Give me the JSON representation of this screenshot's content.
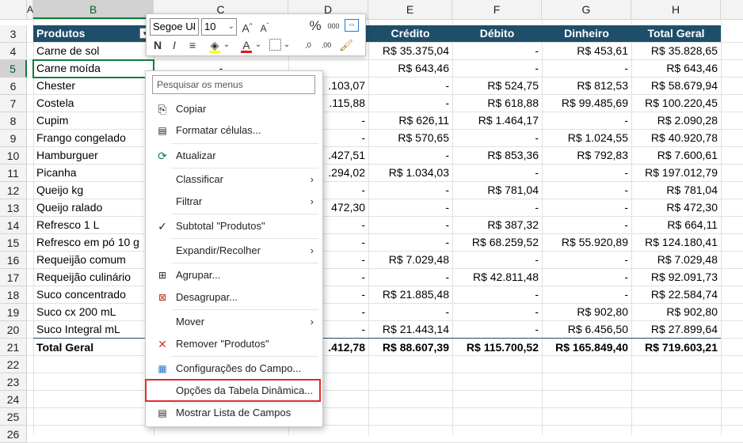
{
  "column_headers": [
    "A",
    "B",
    "C",
    "D",
    "E",
    "F",
    "G",
    "H"
  ],
  "row_numbers": [
    "3",
    "4",
    "5",
    "6",
    "7",
    "8",
    "9",
    "10",
    "11",
    "12",
    "13",
    "14",
    "15",
    "16",
    "17",
    "18",
    "19",
    "20",
    "21",
    "22",
    "23",
    "24",
    "25",
    "26"
  ],
  "pivot": {
    "header": {
      "col_b": "Produtos",
      "col_e": "Crédito",
      "col_f": "Débito",
      "col_g": "Dinheiro",
      "col_h": "Total Geral"
    },
    "rows": [
      {
        "name": "Carne de sol",
        "c": "",
        "d": "",
        "e": "R$ 35.375,04",
        "f": "-",
        "g": "R$ 453,61",
        "h": "R$ 35.828,65"
      },
      {
        "name": "Carne moída",
        "c": "-",
        "d": "",
        "e": "R$ 643,46",
        "f": "-",
        "g": "-",
        "h": "R$ 643,46"
      },
      {
        "name": "Chester",
        "c": "",
        "d": ".103,07",
        "e": "-",
        "f": "R$ 524,75",
        "g": "R$ 812,53",
        "h": "R$ 58.679,94"
      },
      {
        "name": "Costela",
        "c": "",
        "d": ".115,88",
        "e": "-",
        "f": "R$ 618,88",
        "g": "R$ 99.485,69",
        "h": "R$ 100.220,45"
      },
      {
        "name": "Cupim",
        "c": "",
        "d": "-",
        "e": "R$ 626,11",
        "f": "R$ 1.464,17",
        "g": "-",
        "h": "R$ 2.090,28"
      },
      {
        "name": "Frango congelado",
        "c": "",
        "d": "-",
        "e": "R$ 570,65",
        "f": "-",
        "g": "R$ 1.024,55",
        "h": "R$ 40.920,78"
      },
      {
        "name": "Hamburguer",
        "c": "",
        "d": ".427,51",
        "e": "-",
        "f": "R$ 853,36",
        "g": "R$ 792,83",
        "h": "R$ 7.600,61"
      },
      {
        "name": "Picanha",
        "c": "",
        "d": ".294,02",
        "e": "R$ 1.034,03",
        "f": "-",
        "g": "-",
        "h": "R$ 197.012,79"
      },
      {
        "name": "Queijo kg",
        "c": "",
        "d": "-",
        "e": "-",
        "f": "R$ 781,04",
        "g": "-",
        "h": "R$ 781,04"
      },
      {
        "name": "Queijo ralado",
        "c": "",
        "d": "472,30",
        "e": "-",
        "f": "-",
        "g": "-",
        "h": "R$ 472,30"
      },
      {
        "name": "Refresco 1 L",
        "c": "",
        "d": "-",
        "e": "-",
        "f": "R$ 387,32",
        "g": "-",
        "h": "R$ 664,11"
      },
      {
        "name": "Refresco em pó 10 g",
        "c": "",
        "d": "-",
        "e": "-",
        "f": "R$ 68.259,52",
        "g": "R$ 55.920,89",
        "h": "R$ 124.180,41"
      },
      {
        "name": "Requeijão comum",
        "c": "",
        "d": "-",
        "e": "R$ 7.029,48",
        "f": "-",
        "g": "-",
        "h": "R$ 7.029,48"
      },
      {
        "name": "Requeijão culinário",
        "c": "",
        "d": "-",
        "e": "-",
        "f": "R$ 42.811,48",
        "g": "-",
        "h": "R$ 92.091,73"
      },
      {
        "name": "Suco concentrado",
        "c": "",
        "d": "-",
        "e": "R$ 21.885,48",
        "f": "-",
        "g": "-",
        "h": "R$ 22.584,74"
      },
      {
        "name": "Suco cx 200 mL",
        "c": "",
        "d": "-",
        "e": "-",
        "f": "-",
        "g": "R$ 902,80",
        "h": "R$ 902,80"
      },
      {
        "name": "Suco Integral mL",
        "c": "",
        "d": "-",
        "e": "R$ 21.443,14",
        "f": "-",
        "g": "R$ 6.456,50",
        "h": "R$ 27.899,64"
      }
    ],
    "total": {
      "name": "Total Geral",
      "d": ".412,78",
      "e": "R$ 88.607,39",
      "f": "R$ 115.700,52",
      "g": "R$ 165.849,40",
      "h": "R$ 719.603,21"
    }
  },
  "mini_toolbar": {
    "font_name": "Segoe UI",
    "font_size": "10",
    "grow_font": "A",
    "shrink_font": "A",
    "percent": "%",
    "thousands": "000",
    "bold": "N",
    "italic": "I",
    "font_color_letter": "A",
    "dec_increase": ",0",
    "dec_decrease": ",00"
  },
  "context_menu": {
    "search_placeholder": "Pesquisar os menus",
    "items": {
      "copy": "Copiar",
      "format_cells": "Formatar células...",
      "refresh": "Atualizar",
      "sort": "Classificar",
      "filter": "Filtrar",
      "subtotal": "Subtotal \"Produtos\"",
      "expand": "Expandir/Recolher",
      "group": "Agrupar...",
      "ungroup": "Desagrupar...",
      "move": "Mover",
      "remove": "Remover \"Produtos\"",
      "field_settings": "Configurações do Campo...",
      "pivot_options": "Opções da Tabela Dinâmica...",
      "show_field_list": "Mostrar Lista de Campos"
    }
  },
  "colors": {
    "accent": "#107c41",
    "header_band": "#1f4e6a",
    "highlight": "#e02b2b"
  }
}
